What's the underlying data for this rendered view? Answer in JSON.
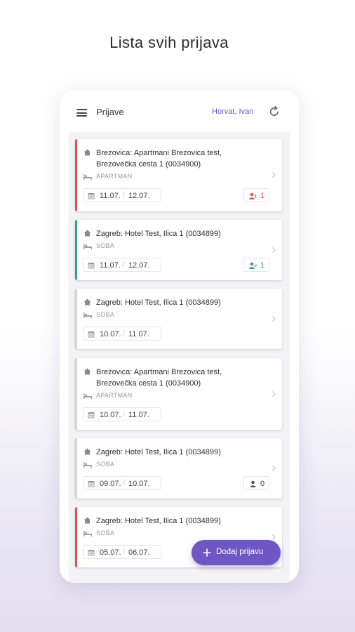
{
  "headline": "Lista svih prijava",
  "appbar": {
    "title": "Prijave",
    "user": "Horvat, Ivan"
  },
  "colors": {
    "accent": "#6e57c4",
    "warning": "#d9534f",
    "success": "#3a9c8e"
  },
  "cards": [
    {
      "location": "Brezovica: Apartmani Brezovica test, Brezovečka cesta 1 (0034900)",
      "type": "APARTMAN",
      "date_in": "11.07.",
      "date_out": "12.07.",
      "guests": "1",
      "status": "red"
    },
    {
      "location": "Zagreb: Hotel Test, Ilica 1 (0034899)",
      "type": "SOBA",
      "date_in": "11.07.",
      "date_out": "12.07.",
      "guests": "1",
      "status": "teal"
    },
    {
      "location": "Zagreb: Hotel Test, Ilica 1 (0034899)",
      "type": "SOBA",
      "date_in": "10.07.",
      "date_out": "11.07.",
      "guests": "",
      "status": "none"
    },
    {
      "location": "Brezovica: Apartmani Brezovica test, Brezovečka cesta 1 (0034900)",
      "type": "APARTMAN",
      "date_in": "10.07.",
      "date_out": "11.07.",
      "guests": "",
      "status": "none"
    },
    {
      "location": "Zagreb: Hotel Test, Ilica 1 (0034899)",
      "type": "SOBA",
      "date_in": "09.07.",
      "date_out": "10.07.",
      "guests": "0",
      "status": "none"
    },
    {
      "location": "Zagreb: Hotel Test, Ilica 1 (0034899)",
      "type": "SOBA",
      "date_in": "05.07.",
      "date_out": "06.07.",
      "guests": "",
      "status": "red"
    }
  ],
  "fab": {
    "label": "Dodaj prijavu"
  },
  "icons": {
    "menu": "menu-icon",
    "refresh": "refresh-icon",
    "location": "home-icon",
    "type": "bed-icon",
    "dates": "calendar-icon",
    "guests": "person-icon",
    "chevron": "chevron-right-icon",
    "fab": "plus-icon"
  }
}
